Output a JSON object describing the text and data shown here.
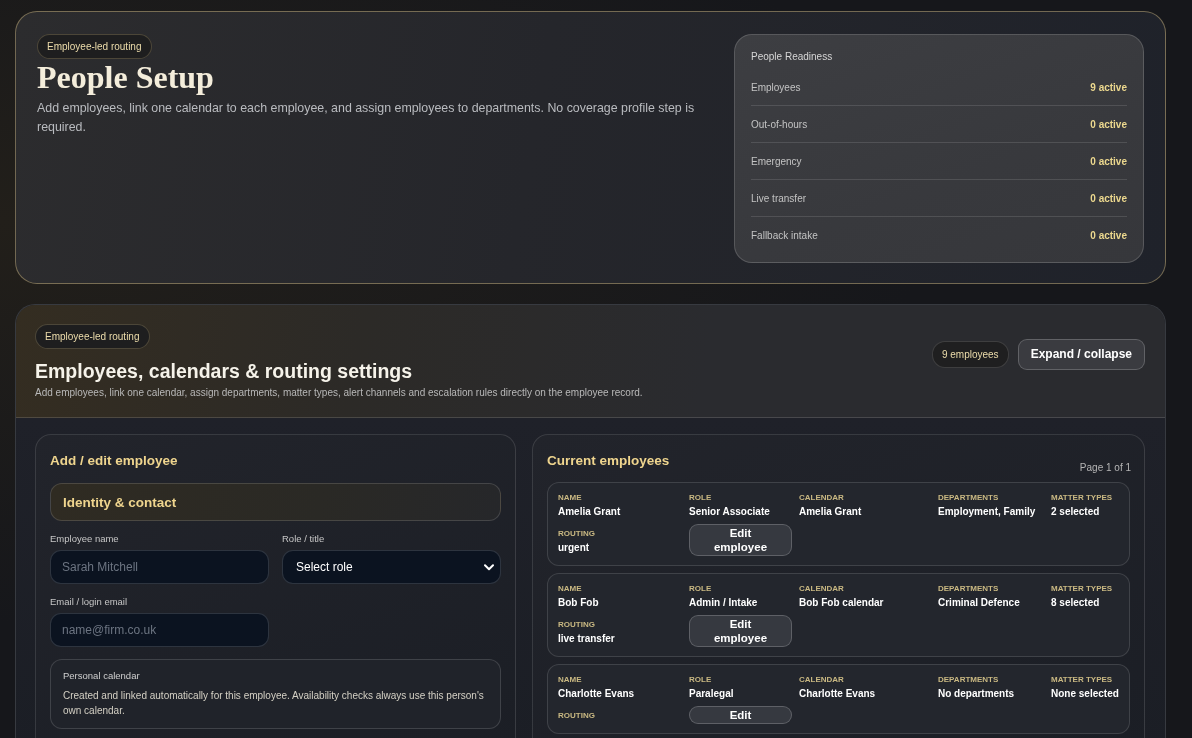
{
  "hero": {
    "badge": "Employee-led routing",
    "title": "People Setup",
    "description": "Add employees, link one calendar to each employee, and assign employees to departments. No coverage profile step is required.",
    "readiness": {
      "title": "People Readiness",
      "rows": [
        {
          "label": "Employees",
          "value": "9 active"
        },
        {
          "label": "Out-of-hours",
          "value": "0 active"
        },
        {
          "label": "Emergency",
          "value": "0 active"
        },
        {
          "label": "Live transfer",
          "value": "0 active"
        },
        {
          "label": "Fallback intake",
          "value": "0 active"
        }
      ]
    }
  },
  "section": {
    "badge": "Employee-led routing",
    "title": "Employees, calendars & routing settings",
    "subtitle": "Add employees, link one calendar, assign departments, matter types, alert channels and escalation rules directly on the employee record.",
    "count": "9 employees",
    "toggle_button": "Expand / collapse"
  },
  "form": {
    "title": "Add / edit employee",
    "group_title": "Identity & contact",
    "fields": [
      {
        "kind": "text",
        "label": "Employee name",
        "placeholder": "Sarah Mitchell"
      },
      {
        "kind": "select",
        "label": "Role / title",
        "value": "Select role"
      },
      {
        "kind": "text",
        "label": "Email / login email",
        "placeholder": "name@firm.co.uk"
      }
    ],
    "note": {
      "title": "Personal calendar",
      "text": "Created and linked automatically for this employee. Availability checks always use this person's own calendar."
    }
  },
  "employees": {
    "title": "Current employees",
    "page": "Page 1 of 1",
    "rows": [
      {
        "fields": [
          {
            "label": "NAME",
            "value": "Amelia Grant"
          },
          {
            "label": "ROLE",
            "value": "Senior Associate"
          },
          {
            "label": "CALENDAR",
            "value": "Amelia Grant"
          },
          {
            "label": "DEPARTMENTS",
            "value": "Employment, Family"
          },
          {
            "label": "MATTER TYPES",
            "value": "2 selected"
          }
        ],
        "routing": {
          "label": "ROUTING",
          "value": "urgent"
        },
        "edit_button": "Edit employee"
      },
      {
        "fields": [
          {
            "label": "NAME",
            "value": "Bob Fob"
          },
          {
            "label": "ROLE",
            "value": "Admin / Intake"
          },
          {
            "label": "CALENDAR",
            "value": "Bob Fob calendar"
          },
          {
            "label": "DEPARTMENTS",
            "value": "Criminal Defence"
          },
          {
            "label": "MATTER TYPES",
            "value": "8 selected"
          }
        ],
        "routing": {
          "label": "ROUTING",
          "value": "live transfer"
        },
        "edit_button": "Edit employee"
      },
      {
        "fields": [
          {
            "label": "NAME",
            "value": "Charlotte Evans"
          },
          {
            "label": "ROLE",
            "value": "Paralegal"
          },
          {
            "label": "CALENDAR",
            "value": "Charlotte Evans"
          },
          {
            "label": "DEPARTMENTS",
            "value": "No departments"
          },
          {
            "label": "MATTER TYPES",
            "value": "None selected"
          }
        ],
        "routing": {
          "label": "ROUTING"
        },
        "edit_button": "Edit"
      }
    ]
  }
}
